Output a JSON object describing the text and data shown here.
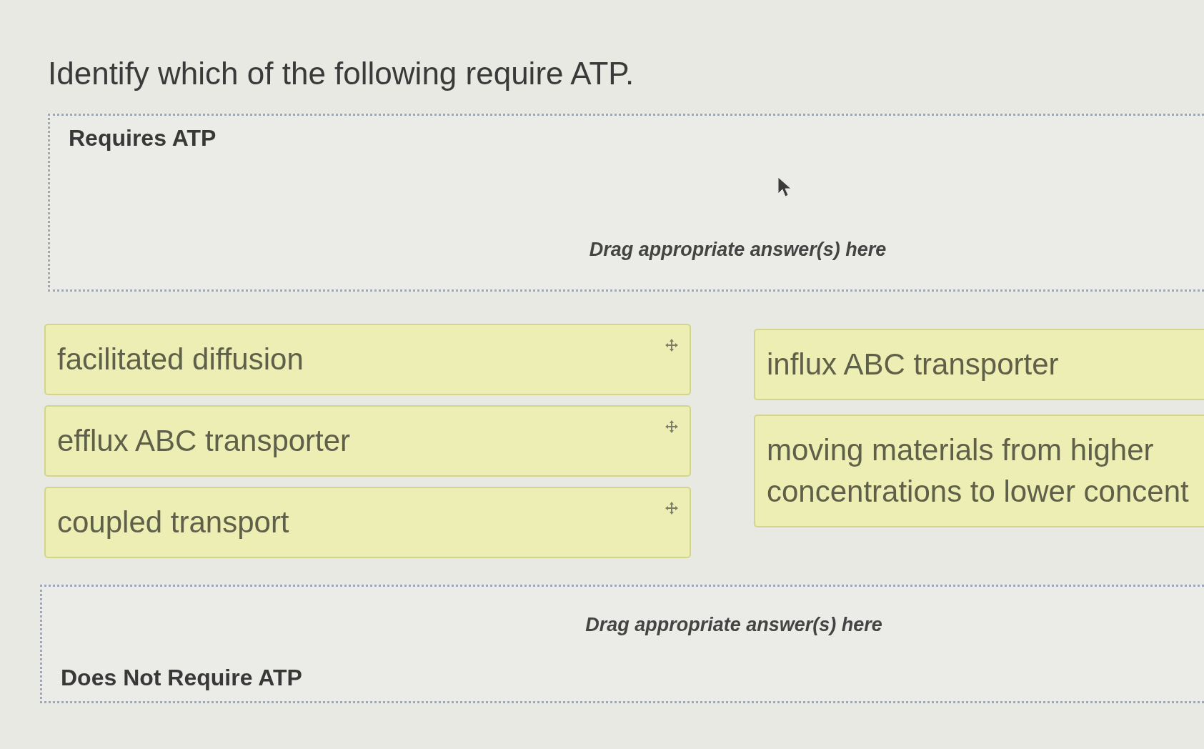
{
  "question": {
    "title": "Identify which of the following require ATP."
  },
  "parts": [
    {
      "kind": "drop_zone",
      "label": "Requires ATP",
      "placeholder": "Drag appropriate answer(s) here"
    },
    {
      "kind": "answer_bank",
      "columns": [
        [
          {
            "text": "facilitated diffusion",
            "drag_handle": true
          },
          {
            "text": "efflux ABC transporter",
            "drag_handle": true
          },
          {
            "text": "coupled transport",
            "drag_handle": true
          }
        ],
        [
          {
            "text": "influx ABC transporter",
            "drag_handle": false
          },
          {
            "text": "moving materials from higher concentrations to lower concent",
            "drag_handle": false
          }
        ]
      ]
    },
    {
      "kind": "drop_zone",
      "label": "Does Not Require ATP",
      "placeholder": "Drag appropriate answer(s) here"
    }
  ]
}
